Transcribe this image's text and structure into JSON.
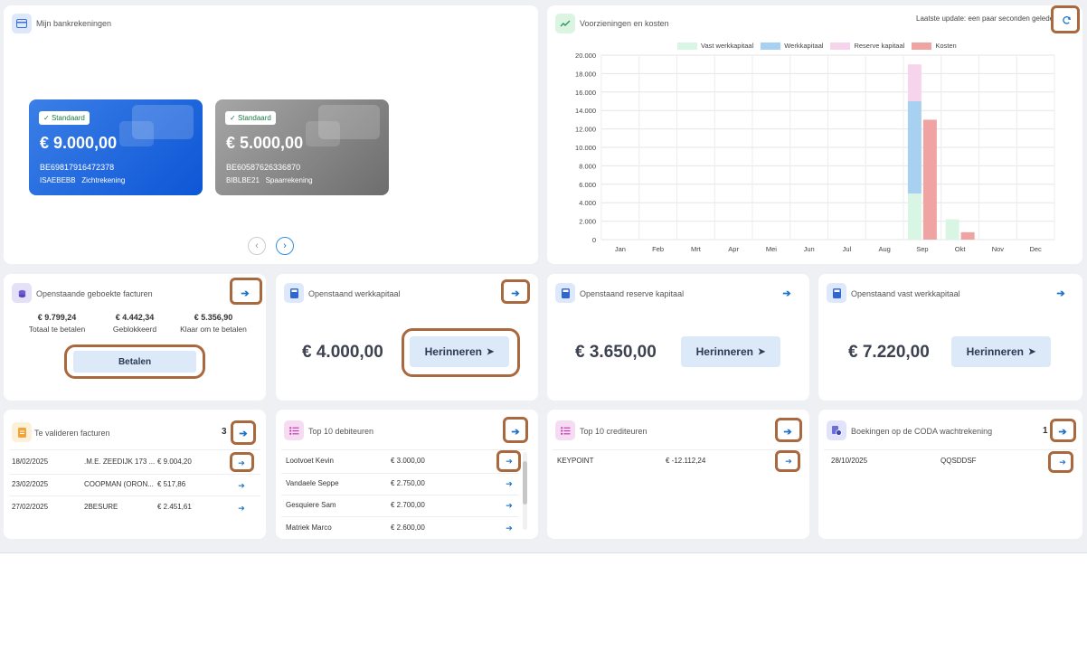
{
  "bank_accounts": {
    "title": "Mijn bankrekeningen",
    "accounts": [
      {
        "badge": "Standaard",
        "amount": "€ 9.000,00",
        "iban": "BE69817916472378",
        "bic": "ISAEBEBB",
        "type": "Zichtrekening"
      },
      {
        "badge": "Standaard",
        "amount": "€ 5.000,00",
        "iban": "BE60587626336870",
        "bic": "BIBLBE21",
        "type": "Spaarrekening"
      }
    ],
    "prev_icon": "chevron-left-icon",
    "next_icon": "chevron-right-icon"
  },
  "provisions": {
    "title": "Voorzieningen en kosten",
    "last_update": "Laatste update: een paar seconden geleden",
    "refresh_icon": "refresh-icon"
  },
  "chart_data": {
    "type": "bar",
    "categories": [
      "Jan",
      "Feb",
      "Mrt",
      "Apr",
      "Mei",
      "Jun",
      "Jul",
      "Aug",
      "Sep",
      "Okt",
      "Nov",
      "Dec"
    ],
    "y_ticks": [
      "0",
      "2.000",
      "4.000",
      "6.000",
      "8.000",
      "10.000",
      "12.000",
      "14.000",
      "16.000",
      "18.000",
      "20.000"
    ],
    "ylim": [
      0,
      20000
    ],
    "legend_position": "top-center",
    "grid": true,
    "stacked_series": [
      {
        "name": "Vast werkkapitaal",
        "color": "#d9f5e3",
        "values": [
          0,
          0,
          0,
          0,
          0,
          0,
          0,
          0,
          5000,
          2200,
          0,
          0
        ]
      },
      {
        "name": "Werkkapitaal",
        "color": "#a8d0f0",
        "values": [
          0,
          0,
          0,
          0,
          0,
          0,
          0,
          0,
          10000,
          0,
          0,
          0
        ]
      },
      {
        "name": "Reserve kapitaal",
        "color": "#f6d5ec",
        "values": [
          0,
          0,
          0,
          0,
          0,
          0,
          0,
          0,
          4000,
          0,
          0,
          0
        ]
      }
    ],
    "separate_series": {
      "name": "Kosten",
      "color": "#efa3a3",
      "values": [
        0,
        0,
        0,
        0,
        0,
        0,
        0,
        0,
        13000,
        800,
        0,
        0
      ]
    }
  },
  "invoices": {
    "title": "Openstaande geboekte facturen",
    "stats": [
      {
        "value": "€ 9.799,24",
        "label": "Totaal te betalen"
      },
      {
        "value": "€ 4.442,34",
        "label": "Geblokkeerd"
      },
      {
        "value": "€ 5.356,90",
        "label": "Klaar om te betalen"
      }
    ],
    "pay_label": "Betalen"
  },
  "working_capital": {
    "title": "Openstaand werkkapitaal",
    "amount": "€ 4.000,00",
    "remind_label": "Herinneren"
  },
  "reserve_capital": {
    "title": "Openstaand reserve kapitaal",
    "amount": "€ 3.650,00",
    "remind_label": "Herinneren"
  },
  "fixed_capital": {
    "title": "Openstaand vast werkkapitaal",
    "amount": "€ 7.220,00",
    "remind_label": "Herinneren"
  },
  "validate": {
    "title": "Te valideren facturen",
    "count": "3",
    "rows": [
      {
        "date": "18/02/2025",
        "name": ".M.E. ZEEDIJK 173 ...",
        "amount": "€ 9.004,20"
      },
      {
        "date": "23/02/2025",
        "name": "COOPMAN (ORON...",
        "amount": "€ 517,86"
      },
      {
        "date": "27/02/2025",
        "name": "2BESURE",
        "amount": "€ 2.451,61"
      }
    ]
  },
  "debtors": {
    "title": "Top 10 debiteuren",
    "rows": [
      {
        "name": "Lootvoet Kevin",
        "amount": "€ 3.000,00"
      },
      {
        "name": "Vandaele Seppe",
        "amount": "€ 2.750,00"
      },
      {
        "name": "Gesquiere Sam",
        "amount": "€ 2.700,00"
      },
      {
        "name": "Matriek Marco",
        "amount": "€ 2.600,00"
      }
    ]
  },
  "creditors": {
    "title": "Top 10 crediteuren",
    "rows": [
      {
        "name": "KEYPOINT",
        "amount": "€ -12.112,24"
      }
    ]
  },
  "coda": {
    "title": "Boekingen op de CODA wachtrekening",
    "count": "1",
    "rows": [
      {
        "date": "28/10/2025",
        "ref": "QQSDDSF"
      }
    ]
  }
}
